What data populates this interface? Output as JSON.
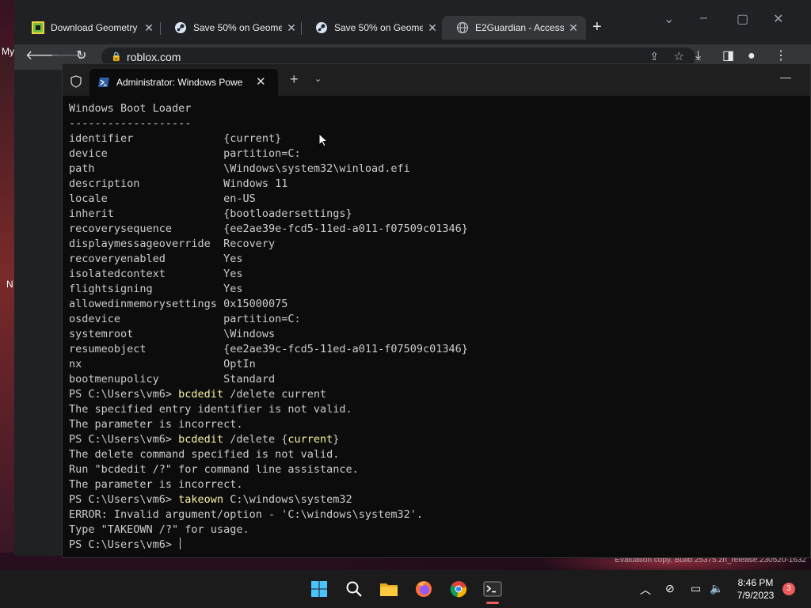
{
  "colors": {
    "terminal_bg": "#0c0c0c",
    "terminal_text": "#cccccc",
    "command_highlight": "#f9f1a5",
    "chrome_bg": "#202124",
    "taskbar_bg": "#1b1b1b",
    "notification_badge": "#f15a5a"
  },
  "chrome": {
    "tabs": [
      {
        "title": "Download Geometry",
        "icon": "geometry-dash-icon"
      },
      {
        "title": "Save 50% on Geome",
        "icon": "steam-icon"
      },
      {
        "title": "Save 50% on Geome",
        "icon": "steam-icon"
      },
      {
        "title": "E2Guardian - Access",
        "icon": "globe-icon",
        "active": true
      }
    ],
    "url": "roblox.com"
  },
  "desktop": {
    "fragment_my": "My",
    "fragment_n": "N",
    "evaluation_text": "Evaluation copy. Build 25375.zn_release.230520-1632"
  },
  "terminal": {
    "tab_title": "Administrator: Windows Powe",
    "lines": [
      {
        "text": "Windows Boot Loader"
      },
      {
        "text": "-------------------"
      },
      {
        "text": "identifier              {current}"
      },
      {
        "text": "device                  partition=C:"
      },
      {
        "text": "path                    \\Windows\\system32\\winload.efi"
      },
      {
        "text": "description             Windows 11"
      },
      {
        "text": "locale                  en-US"
      },
      {
        "text": "inherit                 {bootloadersettings}"
      },
      {
        "text": "recoverysequence        {ee2ae39e-fcd5-11ed-a011-f07509c01346}"
      },
      {
        "text": "displaymessageoverride  Recovery"
      },
      {
        "text": "recoveryenabled         Yes"
      },
      {
        "text": "isolatedcontext         Yes"
      },
      {
        "text": "flightsigning           Yes"
      },
      {
        "text": "allowedinmemorysettings 0x15000075"
      },
      {
        "text": "osdevice                partition=C:"
      },
      {
        "text": "systemroot              \\Windows"
      },
      {
        "text": "resumeobject            {ee2ae39c-fcd5-11ed-a011-f07509c01346}"
      },
      {
        "text": "nx                      OptIn"
      },
      {
        "text": "bootmenupolicy          Standard"
      },
      {
        "prompt": "PS C:\\Users\\vm6> ",
        "cmd": "bcdedit",
        "args": " /delete current"
      },
      {
        "text": "The specified entry identifier is not valid."
      },
      {
        "text": "The parameter is incorrect."
      },
      {
        "prompt": "PS C:\\Users\\vm6> ",
        "cmd": "bcdedit",
        "args": " /delete {",
        "args_hl": "current",
        "args_end": "}"
      },
      {
        "text": "The delete command specified is not valid."
      },
      {
        "text": "Run \"bcdedit /?\" for command line assistance."
      },
      {
        "text": "The parameter is incorrect."
      },
      {
        "prompt": "PS C:\\Users\\vm6> ",
        "cmd": "takeown",
        "args": " C:\\windows\\system32"
      },
      {
        "text": "ERROR: Invalid argument/option - 'C:\\windows\\system32'."
      },
      {
        "text": "Type \"TAKEOWN /?\" for usage."
      },
      {
        "prompt": "PS C:\\Users\\vm6> ",
        "cursor": true
      }
    ]
  },
  "taskbar": {
    "apps": [
      "windows-start-icon",
      "search-icon",
      "file-explorer-icon",
      "firefox-icon",
      "chrome-icon",
      "terminal-icon"
    ],
    "time": "8:46 PM",
    "date": "7/9/2023",
    "notification_count": "3"
  }
}
